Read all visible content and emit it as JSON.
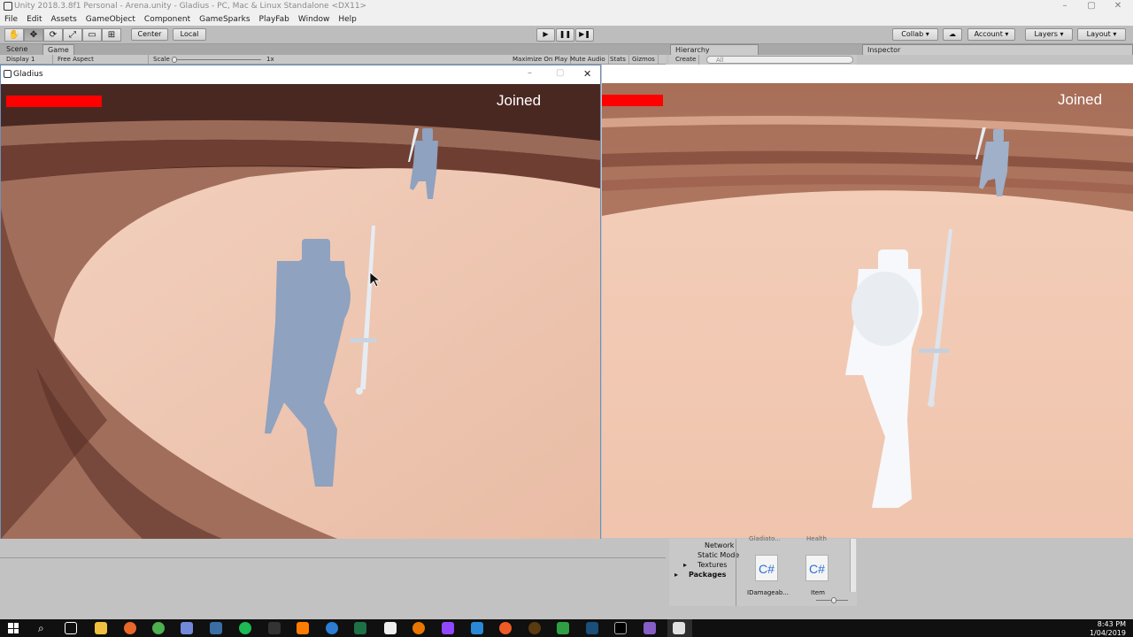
{
  "window": {
    "title": "Unity 2018.3.8f1 Personal - Arena.unity - Gladius - PC, Mac & Linux Standalone <DX11>",
    "min": "–",
    "max": "▢",
    "close": "✕"
  },
  "menu": [
    "File",
    "Edit",
    "Assets",
    "GameObject",
    "Component",
    "GameSparks",
    "PlayFab",
    "Window",
    "Help"
  ],
  "toolbar": {
    "tools": [
      "✋",
      "✥",
      "⟳",
      "⤢",
      "▭",
      "⊞"
    ],
    "pivot": "Center",
    "space": "Local",
    "play": "▶",
    "pause": "❚❚",
    "step": "▶❚",
    "collab": "Collab ▾",
    "cloud": "☁",
    "account": "Account",
    "layers": "Layers",
    "layout": "Layout",
    "caret": "▾"
  },
  "tabs": {
    "scene": "Scene",
    "game": "Game",
    "hierarchy": "Hierarchy",
    "inspector": "Inspector"
  },
  "game_controls": {
    "display": "Display 1",
    "aspect": "Free Aspect",
    "scale_label": "Scale",
    "scale_value": "1x",
    "maximize": "Maximize On Play",
    "mute": "Mute Audio",
    "stats": "Stats",
    "gizmos": "Gizmos"
  },
  "hierarchy": {
    "create": "Create",
    "search_placeholder": "All"
  },
  "game_window_left": {
    "title": "Gladius",
    "status": "Joined",
    "close": "✕",
    "min": "–",
    "max": "▢"
  },
  "game_window_right": {
    "status": "Joined"
  },
  "project": {
    "tree": [
      "Network",
      "Static Mode",
      "Textures",
      "Packages"
    ],
    "top_labels": [
      "Gladiato...",
      "Health"
    ],
    "files": [
      {
        "icon": "C#",
        "name": "IDamageab..."
      },
      {
        "icon": "C#",
        "name": "Item"
      }
    ]
  },
  "taskbar": {
    "time": "8:43 PM",
    "date": "1/04/2019"
  },
  "colors": {
    "health": "#ff0000",
    "sand": "#efc5b0",
    "wall_dark": "#6b3b2e"
  }
}
